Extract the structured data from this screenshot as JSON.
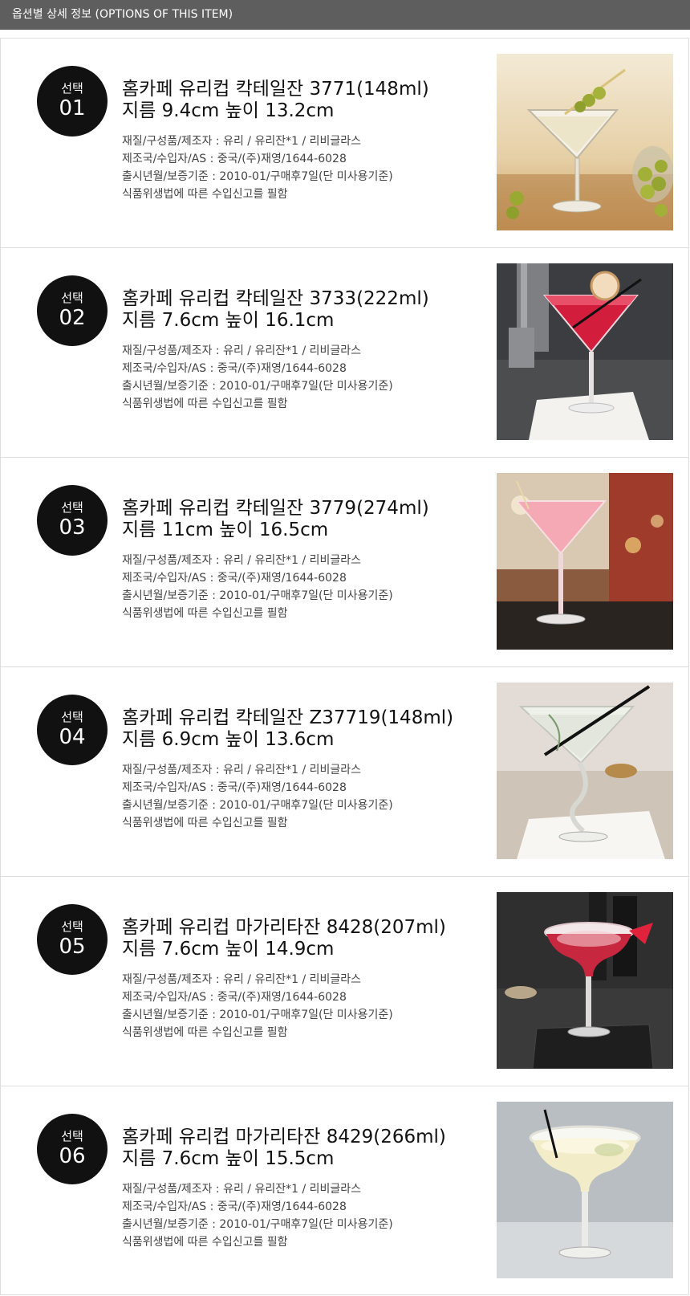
{
  "header": {
    "title": "옵션별 상세 정보 (OPTIONS OF THIS ITEM)"
  },
  "items": [
    {
      "badge_label": "선택",
      "badge_number": "01",
      "title_line1": "홈카페 유리컵 칵테일잔 3771(148ml)",
      "title_line2": "지름 9.4cm 높이 13.2cm",
      "specs": [
        "재질/구성품/제조자 : 유리 / 유리잔*1 / 리비글라스",
        "제조국/수입자/AS : 중국/(주)재영/1644-6028",
        "출시년월/보증기준 : 2010-01/구매후7일(단 미사용기준)",
        "식품위생법에 따른 수입신고를 필함"
      ]
    },
    {
      "badge_label": "선택",
      "badge_number": "02",
      "title_line1": "홈카페 유리컵 칵테일잔 3733(222ml)",
      "title_line2": "지름 7.6cm 높이 16.1cm",
      "specs": [
        "재질/구성품/제조자 : 유리 / 유리잔*1 / 리비글라스",
        "제조국/수입자/AS : 중국/(주)재영/1644-6028",
        "출시년월/보증기준 : 2010-01/구매후7일(단 미사용기준)",
        "식품위생법에 따른 수입신고를 필함"
      ]
    },
    {
      "badge_label": "선택",
      "badge_number": "03",
      "title_line1": "홈카페 유리컵 칵테일잔 3779(274ml)",
      "title_line2": "지름 11cm 높이 16.5cm",
      "specs": [
        "재질/구성품/제조자 : 유리 / 유리잔*1 / 리비글라스",
        "제조국/수입자/AS : 중국/(주)재영/1644-6028",
        "출시년월/보증기준 : 2010-01/구매후7일(단 미사용기준)",
        "식품위생법에 따른 수입신고를 필함"
      ]
    },
    {
      "badge_label": "선택",
      "badge_number": "04",
      "title_line1": "홈카페 유리컵 칵테일잔 Z37719(148ml)",
      "title_line2": "지름 6.9cm 높이 13.6cm",
      "specs": [
        "재질/구성품/제조자 : 유리 / 유리잔*1 / 리비글라스",
        "제조국/수입자/AS : 중국/(주)재영/1644-6028",
        "출시년월/보증기준 : 2010-01/구매후7일(단 미사용기준)",
        "식품위생법에 따른 수입신고를 필함"
      ]
    },
    {
      "badge_label": "선택",
      "badge_number": "05",
      "title_line1": "홈카페 유리컵 마가리타잔 8428(207ml)",
      "title_line2": "지름 7.6cm 높이 14.9cm",
      "specs": [
        "재질/구성품/제조자 : 유리 / 유리잔*1 / 리비글라스",
        "제조국/수입자/AS : 중국/(주)재영/1644-6028",
        "출시년월/보증기준 : 2010-01/구매후7일(단 미사용기준)",
        "식품위생법에 따른 수입신고를 필함"
      ]
    },
    {
      "badge_label": "선택",
      "badge_number": "06",
      "title_line1": "홈카페 유리컵 마가리타잔 8429(266ml)",
      "title_line2": "지름 7.6cm 높이 15.5cm",
      "specs": [
        "재질/구성품/제조자 : 유리 / 유리잔*1 / 리비글라스",
        "제조국/수입자/AS : 중국/(주)재영/1644-6028",
        "출시년월/보증기준 : 2010-01/구매후7일(단 미사용기준)",
        "식품위생법에 따른 수입신고를 필함"
      ]
    }
  ]
}
